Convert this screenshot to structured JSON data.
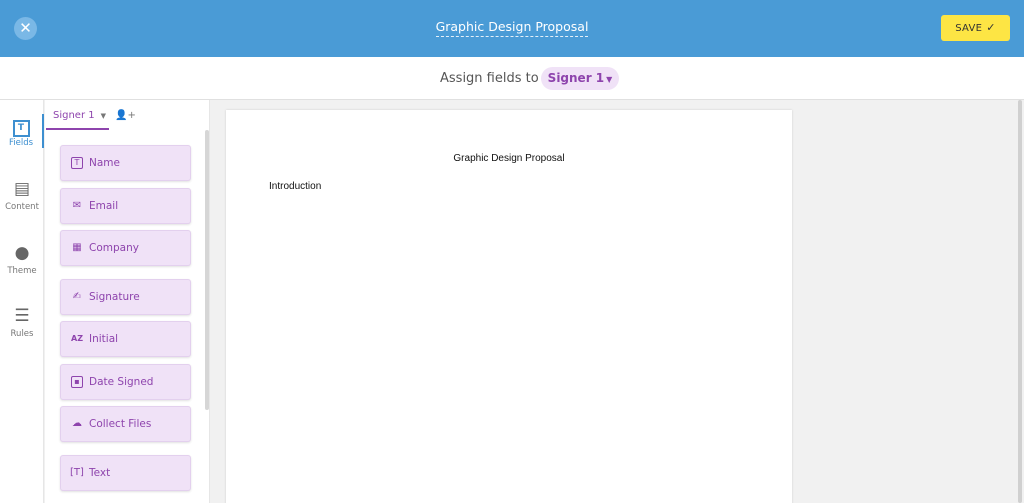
{
  "topbar": {
    "close_icon": "x-icon",
    "title": "Graphic Design Proposal",
    "save_label": "SAVE",
    "save_icon": "check-icon",
    "colors": {
      "bar": "#4a9bd6",
      "save": "#fde544"
    }
  },
  "assign": {
    "label": "Assign fields to",
    "signer": "Signer 1"
  },
  "rail": [
    {
      "label": "Fields",
      "icon": "fields-icon",
      "active": true
    },
    {
      "label": "Content",
      "icon": "content-icon",
      "active": false
    },
    {
      "label": "Theme",
      "icon": "palette-icon",
      "active": false
    },
    {
      "label": "Rules",
      "icon": "rules-icon",
      "active": false
    }
  ],
  "panel": {
    "signer_tab": "Signer 1",
    "add_signer_icon": "add-person-icon",
    "fields": [
      {
        "label": "Name",
        "icon": "text-box-icon"
      },
      {
        "label": "Email",
        "icon": "envelope-icon"
      },
      {
        "label": "Company",
        "icon": "building-icon"
      },
      {
        "label": "Signature",
        "icon": "signature-icon"
      },
      {
        "label": "Initial",
        "icon": "az-icon"
      },
      {
        "label": "Date Signed",
        "icon": "calendar-icon"
      },
      {
        "label": "Collect Files",
        "icon": "cloud-upload-icon"
      },
      {
        "label": "Text",
        "icon": "text-cursor-icon"
      }
    ],
    "accent": "#8e44ad"
  },
  "document": {
    "title": "Graphic Design Proposal",
    "heading": "Introduction"
  }
}
